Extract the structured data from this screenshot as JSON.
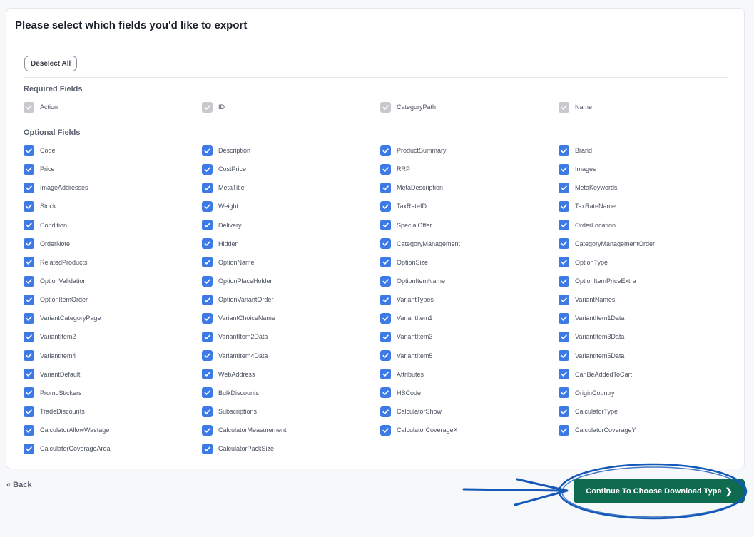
{
  "title": "Please select which fields you'd like to export",
  "deselect_label": "Deselect All",
  "required": {
    "heading": "Required Fields",
    "fields": [
      "Action",
      "ID",
      "CategoryPath",
      "Name"
    ]
  },
  "optional": {
    "heading": "Optional Fields",
    "fields": [
      "Code",
      "Description",
      "ProductSummary",
      "Brand",
      "Price",
      "CostPrice",
      "RRP",
      "Images",
      "ImageAddresses",
      "MetaTitle",
      "MetaDescription",
      "MetaKeywords",
      "Stock",
      "Weight",
      "TaxRateID",
      "TaxRateName",
      "Condition",
      "Delivery",
      "SpecialOffer",
      "OrderLocation",
      "OrderNote",
      "Hidden",
      "CategoryManagement",
      "CategoryManagementOrder",
      "RelatedProducts",
      "OptionName",
      "OptionSize",
      "OptionType",
      "OptionValidation",
      "OptionPlaceHolder",
      "OptionItemName",
      "OptionItemPriceExtra",
      "OptionItemOrder",
      "OptionVariantOrder",
      "VariantTypes",
      "VariantNames",
      "VariantCategoryPage",
      "VariantChoiceName",
      "VariantItem1",
      "VariantItem1Data",
      "VariantItem2",
      "VariantItem2Data",
      "VariantItem3",
      "VariantItem3Data",
      "VariantItem4",
      "VariantItem4Data",
      "VariantItem5",
      "VariantItem5Data",
      "VariantDefault",
      "WebAddress",
      "Attributes",
      "CanBeAddedToCart",
      "PromoStickers",
      "BulkDiscounts",
      "HSCode",
      "OriginCountry",
      "TradeDiscounts",
      "Subscriptions",
      "CalculatorShow",
      "CalculatorType",
      "CalculatorAllowWastage",
      "CalculatorMeasurement",
      "CalculatorCoverageX",
      "CalculatorCoverageY",
      "CalculatorCoverageArea",
      "CalculatorPackSize"
    ]
  },
  "back_label": "« Back",
  "continue_label": "Continue To Choose Download Type",
  "colors": {
    "checkbox": "#3d7ae6",
    "checkbox_disabled": "#c7c9cc",
    "continue_button": "#0e6b4e",
    "annotation": "#1458b8"
  }
}
